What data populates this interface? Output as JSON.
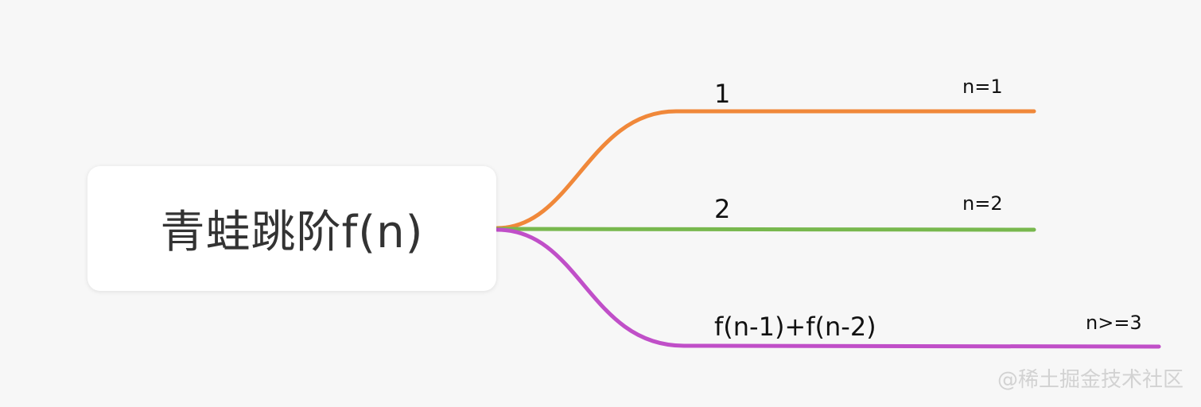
{
  "root": {
    "label": "青蛙跳阶f(n)"
  },
  "branches": [
    {
      "value": "1",
      "condition": "n=1",
      "color": "#f0883a"
    },
    {
      "value": "2",
      "condition": "n=2",
      "color": "#78b84e"
    },
    {
      "value": "f(n-1)+f(n-2)",
      "condition": "n>=3",
      "color": "#c04fc8"
    }
  ],
  "watermark": "@稀土掘金技术社区"
}
